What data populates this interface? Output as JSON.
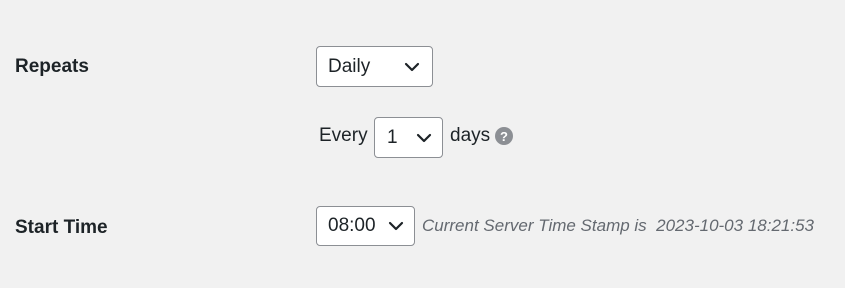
{
  "repeats": {
    "label": "Repeats",
    "selected": "Daily"
  },
  "interval": {
    "prefix": "Every",
    "selected": "1",
    "suffix": "days",
    "help_icon": "question-circle-icon",
    "help_glyph": "?"
  },
  "start_time": {
    "label": "Start Time",
    "selected": "08:00",
    "server_time_text": "Current Server Time Stamp is  2023-10-03 18:21:53"
  },
  "colors": {
    "background": "#f1f1f1",
    "text": "#1d2327",
    "muted": "#646970",
    "border": "#8c8f94"
  }
}
